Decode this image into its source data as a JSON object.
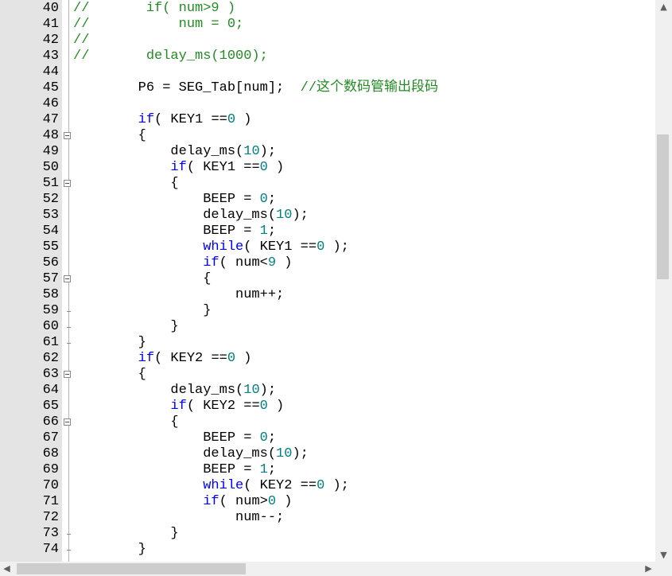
{
  "colors": {
    "comment": "#228b22",
    "keyword": "#0000ff",
    "number": "#008080",
    "plain": "#000000",
    "gutter": "#e4e4e4"
  },
  "lines": [
    {
      "n": "40",
      "fold": "none",
      "tokens": [
        [
          "comment",
          "//       if( num>9 )"
        ]
      ]
    },
    {
      "n": "41",
      "fold": "none",
      "tokens": [
        [
          "comment",
          "//           num = 0;"
        ]
      ]
    },
    {
      "n": "42",
      "fold": "none",
      "tokens": [
        [
          "comment",
          "//"
        ]
      ]
    },
    {
      "n": "43",
      "fold": "none",
      "tokens": [
        [
          "comment",
          "//       delay_ms(1000);"
        ]
      ]
    },
    {
      "n": "44",
      "fold": "none",
      "tokens": []
    },
    {
      "n": "45",
      "fold": "none",
      "tokens": [
        [
          "plain",
          "        P6 = SEG_Tab[num];  "
        ],
        [
          "comment",
          "//这个数码管输出段码"
        ]
      ]
    },
    {
      "n": "46",
      "fold": "none",
      "tokens": []
    },
    {
      "n": "47",
      "fold": "none",
      "tokens": [
        [
          "plain",
          "        "
        ],
        [
          "keyword",
          "if"
        ],
        [
          "plain",
          "( KEY1 =="
        ],
        [
          "number",
          "0"
        ],
        [
          "plain",
          " )"
        ]
      ]
    },
    {
      "n": "48",
      "fold": "open",
      "tokens": [
        [
          "plain",
          "        {"
        ]
      ]
    },
    {
      "n": "49",
      "fold": "none",
      "tokens": [
        [
          "plain",
          "            delay_ms("
        ],
        [
          "number",
          "10"
        ],
        [
          "plain",
          ");"
        ]
      ]
    },
    {
      "n": "50",
      "fold": "none",
      "tokens": [
        [
          "plain",
          "            "
        ],
        [
          "keyword",
          "if"
        ],
        [
          "plain",
          "( KEY1 =="
        ],
        [
          "number",
          "0"
        ],
        [
          "plain",
          " )"
        ]
      ]
    },
    {
      "n": "51",
      "fold": "open",
      "tokens": [
        [
          "plain",
          "            {"
        ]
      ]
    },
    {
      "n": "52",
      "fold": "none",
      "tokens": [
        [
          "plain",
          "                BEEP = "
        ],
        [
          "number",
          "0"
        ],
        [
          "plain",
          ";"
        ]
      ]
    },
    {
      "n": "53",
      "fold": "none",
      "tokens": [
        [
          "plain",
          "                delay_ms("
        ],
        [
          "number",
          "10"
        ],
        [
          "plain",
          ");"
        ]
      ]
    },
    {
      "n": "54",
      "fold": "none",
      "tokens": [
        [
          "plain",
          "                BEEP = "
        ],
        [
          "number",
          "1"
        ],
        [
          "plain",
          ";"
        ]
      ]
    },
    {
      "n": "55",
      "fold": "none",
      "tokens": [
        [
          "plain",
          "                "
        ],
        [
          "keyword",
          "while"
        ],
        [
          "plain",
          "( KEY1 =="
        ],
        [
          "number",
          "0"
        ],
        [
          "plain",
          " );"
        ]
      ]
    },
    {
      "n": "56",
      "fold": "none",
      "tokens": [
        [
          "plain",
          "                "
        ],
        [
          "keyword",
          "if"
        ],
        [
          "plain",
          "( num<"
        ],
        [
          "number",
          "9"
        ],
        [
          "plain",
          " )"
        ]
      ]
    },
    {
      "n": "57",
      "fold": "open",
      "tokens": [
        [
          "plain",
          "                {"
        ]
      ]
    },
    {
      "n": "58",
      "fold": "none",
      "tokens": [
        [
          "plain",
          "                    num++;"
        ]
      ]
    },
    {
      "n": "59",
      "fold": "end",
      "tokens": [
        [
          "plain",
          "                }"
        ]
      ]
    },
    {
      "n": "60",
      "fold": "end",
      "tokens": [
        [
          "plain",
          "            }"
        ]
      ]
    },
    {
      "n": "61",
      "fold": "end",
      "tokens": [
        [
          "plain",
          "        }"
        ]
      ]
    },
    {
      "n": "62",
      "fold": "none",
      "tokens": [
        [
          "plain",
          "        "
        ],
        [
          "keyword",
          "if"
        ],
        [
          "plain",
          "( KEY2 =="
        ],
        [
          "number",
          "0"
        ],
        [
          "plain",
          " )"
        ]
      ]
    },
    {
      "n": "63",
      "fold": "open",
      "tokens": [
        [
          "plain",
          "        {"
        ]
      ]
    },
    {
      "n": "64",
      "fold": "none",
      "tokens": [
        [
          "plain",
          "            delay_ms("
        ],
        [
          "number",
          "10"
        ],
        [
          "plain",
          ");"
        ]
      ]
    },
    {
      "n": "65",
      "fold": "none",
      "tokens": [
        [
          "plain",
          "            "
        ],
        [
          "keyword",
          "if"
        ],
        [
          "plain",
          "( KEY2 =="
        ],
        [
          "number",
          "0"
        ],
        [
          "plain",
          " )"
        ]
      ]
    },
    {
      "n": "66",
      "fold": "open",
      "tokens": [
        [
          "plain",
          "            {"
        ]
      ]
    },
    {
      "n": "67",
      "fold": "none",
      "tokens": [
        [
          "plain",
          "                BEEP = "
        ],
        [
          "number",
          "0"
        ],
        [
          "plain",
          ";"
        ]
      ]
    },
    {
      "n": "68",
      "fold": "none",
      "tokens": [
        [
          "plain",
          "                delay_ms("
        ],
        [
          "number",
          "10"
        ],
        [
          "plain",
          ");"
        ]
      ]
    },
    {
      "n": "69",
      "fold": "none",
      "tokens": [
        [
          "plain",
          "                BEEP = "
        ],
        [
          "number",
          "1"
        ],
        [
          "plain",
          ";"
        ]
      ]
    },
    {
      "n": "70",
      "fold": "none",
      "tokens": [
        [
          "plain",
          "                "
        ],
        [
          "keyword",
          "while"
        ],
        [
          "plain",
          "( KEY2 =="
        ],
        [
          "number",
          "0"
        ],
        [
          "plain",
          " );"
        ]
      ]
    },
    {
      "n": "71",
      "fold": "none",
      "tokens": [
        [
          "plain",
          "                "
        ],
        [
          "keyword",
          "if"
        ],
        [
          "plain",
          "( num>"
        ],
        [
          "number",
          "0"
        ],
        [
          "plain",
          " )"
        ]
      ]
    },
    {
      "n": "72",
      "fold": "none",
      "tokens": [
        [
          "plain",
          "                    num--;"
        ]
      ]
    },
    {
      "n": "73",
      "fold": "end",
      "tokens": [
        [
          "plain",
          "            }"
        ]
      ]
    },
    {
      "n": "74",
      "fold": "end",
      "tokens": [
        [
          "plain",
          "        }"
        ]
      ]
    }
  ],
  "scrollbars": {
    "vertical_position": 0.31,
    "horizontal_position": 0.0,
    "up_icon": "triangle-up-icon",
    "down_icon": "triangle-down-icon",
    "left_icon": "triangle-left-icon",
    "right_icon": "triangle-right-icon"
  }
}
